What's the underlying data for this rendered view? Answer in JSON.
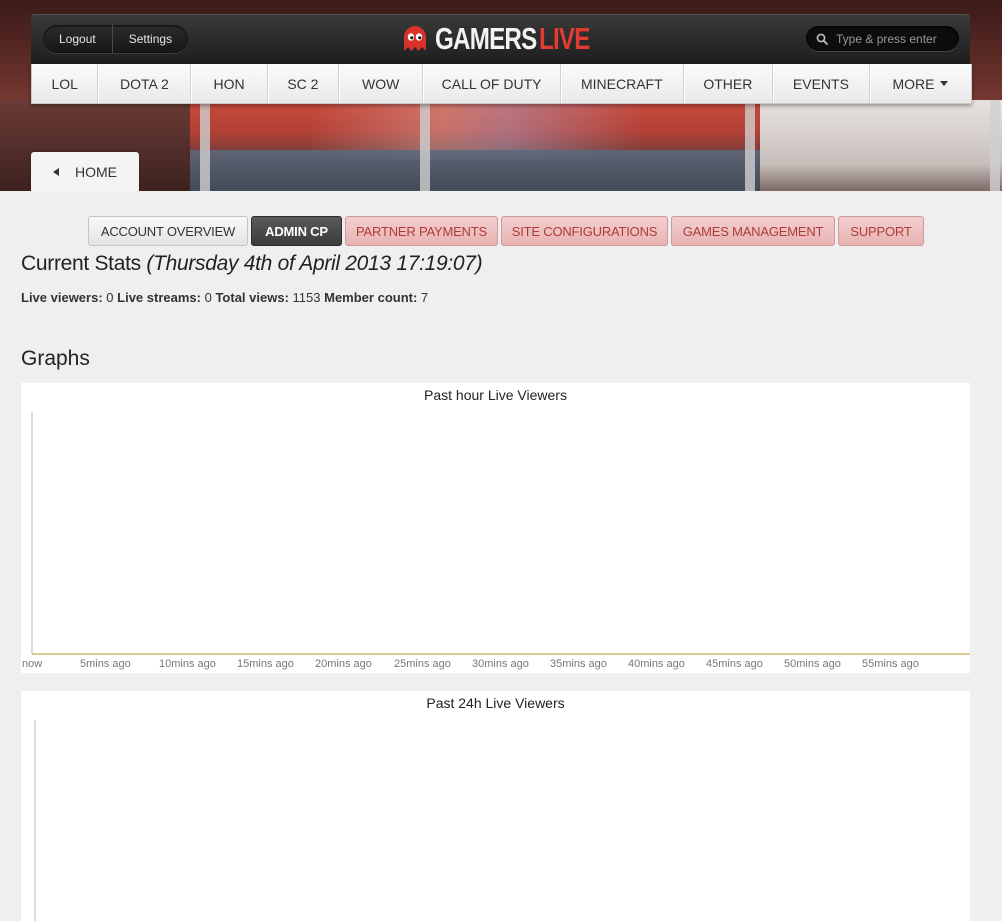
{
  "header": {
    "logout_label": "Logout",
    "settings_label": "Settings",
    "logo_word1": "GAMERS",
    "logo_word2": "LIVE",
    "search_placeholder": "Type & press enter",
    "accent_color": "#e23b34"
  },
  "nav": {
    "items": [
      {
        "label": "LOL",
        "w": 66
      },
      {
        "label": "DOTA 2",
        "w": 93
      },
      {
        "label": "HON",
        "w": 76
      },
      {
        "label": "SC 2",
        "w": 71
      },
      {
        "label": "WOW",
        "w": 84
      },
      {
        "label": "CALL OF DUTY",
        "w": 138
      },
      {
        "label": "MINECRAFT",
        "w": 123
      },
      {
        "label": "OTHER",
        "w": 89
      },
      {
        "label": "EVENTS",
        "w": 97
      },
      {
        "label": "MORE",
        "w": 102
      }
    ]
  },
  "home_tab": {
    "label": "HOME"
  },
  "admin_tabs": [
    {
      "label": "ACCOUNT OVERVIEW",
      "state": "neutral"
    },
    {
      "label": "ADMIN CP",
      "state": "active"
    },
    {
      "label": "PARTNER PAYMENTS",
      "state": "restricted"
    },
    {
      "label": "SITE CONFIGURATIONS",
      "state": "restricted"
    },
    {
      "label": "GAMES MANAGEMENT",
      "state": "restricted"
    },
    {
      "label": "SUPPORT",
      "state": "restricted"
    }
  ],
  "stats": {
    "title": "Current Stats",
    "timestamp": "(Thursday 4th of April 2013 17:19:07)",
    "live_viewers_label": "Live viewers:",
    "live_viewers": "0",
    "live_streams_label": "Live streams:",
    "live_streams": "0",
    "total_views_label": "Total views:",
    "total_views": "1153",
    "member_count_label": "Member count:",
    "member_count": "7"
  },
  "graphs": {
    "title": "Graphs"
  },
  "chart_data": [
    {
      "type": "line",
      "title": "Past hour Live Viewers",
      "categories": [
        "now",
        "5mins ago",
        "10mins ago",
        "15mins ago",
        "20mins ago",
        "25mins ago",
        "30mins ago",
        "35mins ago",
        "40mins ago",
        "45mins ago",
        "50mins ago",
        "55mins ago"
      ],
      "series": [
        {
          "values": [
            0,
            0,
            0,
            0,
            0,
            0,
            0,
            0,
            0,
            0,
            0,
            0
          ],
          "color": "#c8a75a"
        }
      ],
      "xlabel": "",
      "ylabel": "",
      "grid": false
    },
    {
      "type": "line",
      "title": "Past 24h Live Viewers",
      "categories": [],
      "series": [],
      "xlabel": "",
      "ylabel": "",
      "grid": false
    }
  ]
}
